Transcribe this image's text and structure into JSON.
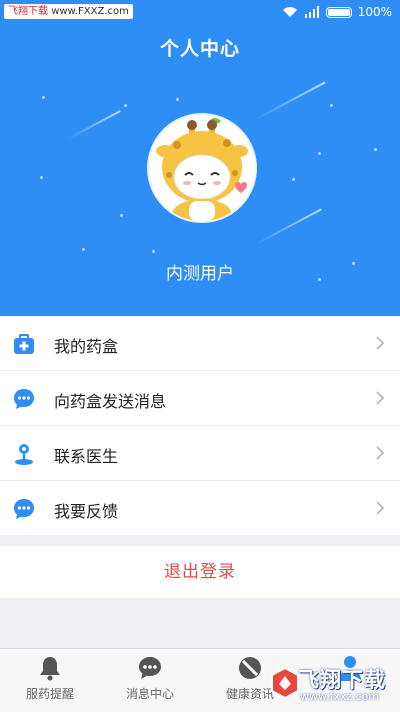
{
  "status_bar": {
    "watermark_text": "飞翔下载",
    "watermark_url": "www.FXXZ.com",
    "battery": "100%"
  },
  "header": {
    "title": "个人中心",
    "username": "内测用户",
    "background_color": "#2e8ef5"
  },
  "menu": {
    "items": [
      {
        "label": "我的药盒",
        "icon": "medicine-box-icon"
      },
      {
        "label": "向药盒发送消息",
        "icon": "chat-bubble-icon"
      },
      {
        "label": "联系医生",
        "icon": "doctor-icon"
      },
      {
        "label": "我要反馈",
        "icon": "chat-bubble-icon"
      }
    ]
  },
  "logout_label": "退出登录",
  "tabbar": {
    "tabs": [
      {
        "label": "服药提醒",
        "icon": "bell-icon"
      },
      {
        "label": "消息中心",
        "icon": "message-icon"
      },
      {
        "label": "健康资讯",
        "icon": "news-icon"
      },
      {
        "label": "",
        "icon": "person-icon",
        "active": true
      }
    ]
  },
  "watermark": {
    "brand": "飞翔下载",
    "url": "www.fxxz.com"
  },
  "colors": {
    "accent": "#2e8ef5",
    "logout_red": "#e24b4b"
  }
}
